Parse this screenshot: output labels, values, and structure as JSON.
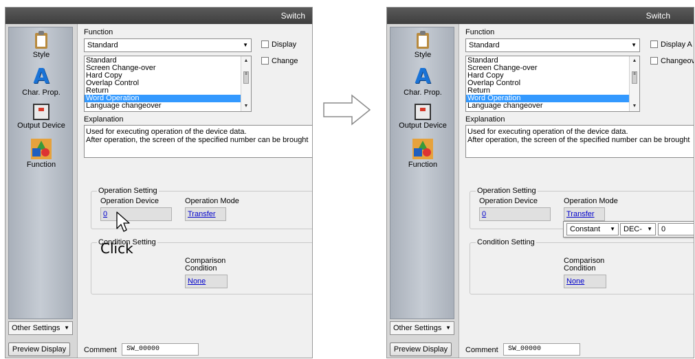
{
  "window": {
    "title": "Switch"
  },
  "sidebar": {
    "items": [
      {
        "label": "Style",
        "icon": "clipboard-icon"
      },
      {
        "label": "Char. Prop.",
        "icon": "char-prop-icon",
        "glyph": "A"
      },
      {
        "label": "Output Device",
        "icon": "output-device-icon"
      },
      {
        "label": "Function",
        "icon": "function-icon"
      }
    ],
    "other_settings": "Other Settings"
  },
  "function": {
    "label": "Function",
    "selected": "Standard",
    "list": [
      "Standard",
      "Screen Change-over",
      "Hard Copy",
      "Overlap Control",
      "Return",
      "Word Operation",
      "Language changeover"
    ],
    "list_selected_index": 5
  },
  "checkboxes": {
    "left": [
      "Display",
      "Change"
    ],
    "right": [
      "Display A",
      "Changeov"
    ]
  },
  "explanation": {
    "label": "Explanation",
    "line1": "Used for executing operation of the device data.",
    "line2": "After operation, the screen of the specified number can be brought"
  },
  "operation_setting": {
    "label": "Operation Setting",
    "device_label": "Operation Device",
    "device_value": "0",
    "mode_label": "Operation Mode",
    "mode_value": "Transfer"
  },
  "condition_setting": {
    "label": "Condition Setting",
    "comparison_label": "Comparison",
    "comparison_label2": "Condition",
    "comparison_value": "None"
  },
  "popup": {
    "source": "Constant",
    "format": "DEC-",
    "value": "0"
  },
  "annotation": {
    "click_text": "Click"
  },
  "footer": {
    "preview_button": "Preview Display",
    "comment_label": "Comment",
    "comment_value": "SW_00000"
  },
  "colors": {
    "titlebar": "#4a4a4a",
    "selection": "#3399ff",
    "link": "#0000cc",
    "sidebar": "#b8bec6"
  }
}
